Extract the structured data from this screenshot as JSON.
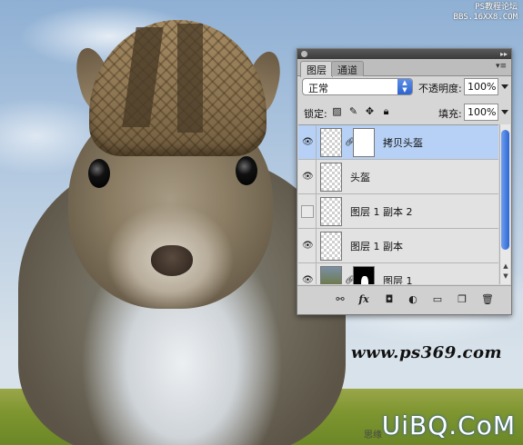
{
  "watermark_top": {
    "line1": "PS教程论坛",
    "line2": "BBS.16XX8.COM"
  },
  "panel": {
    "tabs": [
      {
        "label": "图层",
        "active": true
      },
      {
        "label": "通道",
        "active": false
      }
    ],
    "blend_mode": "正常",
    "opacity_label": "不透明度:",
    "opacity_value": "100%",
    "lock_label": "锁定:",
    "fill_label": "填充:",
    "fill_value": "100%",
    "layers": [
      {
        "name": "拷贝头盔",
        "visible": true,
        "selected": true,
        "has_mask": true,
        "thumb": "transparent",
        "mask": "white"
      },
      {
        "name": "头盔",
        "visible": true,
        "selected": false,
        "has_mask": false,
        "thumb": "transparent"
      },
      {
        "name": "图层 1 副本 2",
        "visible": false,
        "selected": false,
        "has_mask": false,
        "thumb": "transparent"
      },
      {
        "name": "图层 1 副本",
        "visible": true,
        "selected": false,
        "has_mask": false,
        "thumb": "transparent"
      },
      {
        "name": "图层 1",
        "visible": true,
        "selected": false,
        "has_mask": true,
        "thumb": "photo",
        "mask": "black"
      }
    ],
    "bottom_icons": [
      "link-icon",
      "fx-icon",
      "add-mask-icon",
      "adjustment-icon",
      "folder-icon",
      "new-layer-icon",
      "trash-icon"
    ]
  },
  "watermark_url": "www.ps369.com",
  "watermark_bottom": "UiBQ.CoM",
  "watermark_bottom_small": "思缘"
}
